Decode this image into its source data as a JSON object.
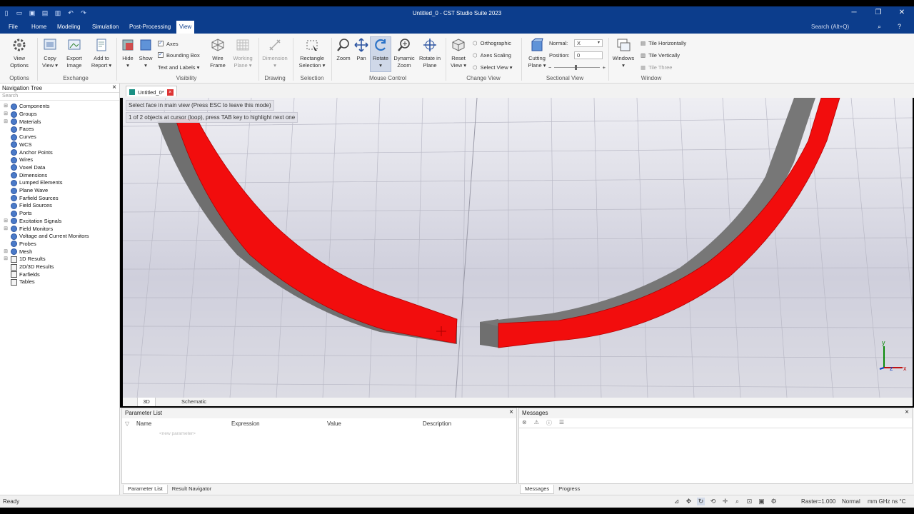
{
  "window": {
    "title": "Untitled_0 - CST Studio Suite 2023",
    "search_placeholder": "Search (Alt+Q)",
    "minimize": "─",
    "maximize": "❐",
    "close": "✕",
    "help": "?"
  },
  "quick_access": [
    "new-file-icon",
    "open-folder-icon",
    "save-icon",
    "save-all-icon",
    "print-icon",
    "undo-icon",
    "redo-icon"
  ],
  "menu": {
    "items": [
      "File",
      "Home",
      "Modeling",
      "Simulation",
      "Post-Processing",
      "View"
    ],
    "active": "View"
  },
  "ribbon": {
    "options": {
      "view_options": "View\nOptions",
      "group": "Options"
    },
    "exchange": {
      "copy_view": "Copy\nView ▾",
      "export_image": "Export\nImage",
      "add_to_report": "Add to\nReport ▾",
      "group": "Exchange"
    },
    "visibility": {
      "hide": "Hide\n▾",
      "show": "Show\n▾",
      "axes": "Axes",
      "bounding_box": "Bounding Box",
      "text_and_labels": "Text and Labels ▾",
      "wire_frame": "Wire\nFrame",
      "working_plane": "Working\nPlane ▾",
      "group": "Visibility"
    },
    "drawing": {
      "dimension": "Dimension\n▾",
      "group": "Drawing"
    },
    "selection": {
      "rectangle_selection": "Rectangle\nSelection ▾",
      "group": "Selection"
    },
    "mouse_control": {
      "zoom": "Zoom",
      "pan": "Pan",
      "rotate": "Rotate\n▾",
      "dynamic_zoom": "Dynamic\nZoom",
      "rotate_in_plane": "Rotate in\nPlane",
      "group": "Mouse Control"
    },
    "change_view": {
      "reset_view": "Reset\nView ▾",
      "orthographic": "Orthographic",
      "axes_scaling": "Axes Scaling",
      "select_view": "Select View ▾",
      "group": "Change View"
    },
    "sectional_view": {
      "cutting_plane": "Cutting\nPlane ▾",
      "normal_label": "Normal:",
      "normal_value": "X",
      "position_label": "Position:",
      "position_value": "0",
      "group": "Sectional View"
    },
    "window": {
      "windows": "Windows\n▾",
      "tile_horizontally": "Tile Horizontally",
      "tile_vertically": "Tile Vertically",
      "tile_three": "Tile Three",
      "group": "Window"
    }
  },
  "navigation_tree": {
    "title": "Navigation Tree",
    "search_placeholder": "Search",
    "items": [
      {
        "label": "Components",
        "expandable": true,
        "icon": "folder-icon"
      },
      {
        "label": "Groups",
        "expandable": true,
        "icon": "folder-icon"
      },
      {
        "label": "Materials",
        "expandable": true,
        "icon": "folder-icon"
      },
      {
        "label": "Faces",
        "expandable": false,
        "icon": "folder-icon"
      },
      {
        "label": "Curves",
        "expandable": false,
        "icon": "folder-icon"
      },
      {
        "label": "WCS",
        "expandable": false,
        "icon": "folder-icon"
      },
      {
        "label": "Anchor Points",
        "expandable": false,
        "icon": "folder-icon"
      },
      {
        "label": "Wires",
        "expandable": false,
        "icon": "folder-icon"
      },
      {
        "label": "Voxel Data",
        "expandable": false,
        "icon": "folder-icon"
      },
      {
        "label": "Dimensions",
        "expandable": false,
        "icon": "folder-icon"
      },
      {
        "label": "Lumped Elements",
        "expandable": false,
        "icon": "folder-icon"
      },
      {
        "label": "Plane Wave",
        "expandable": false,
        "icon": "folder-icon"
      },
      {
        "label": "Farfield Sources",
        "expandable": false,
        "icon": "folder-icon"
      },
      {
        "label": "Field Sources",
        "expandable": false,
        "icon": "folder-icon"
      },
      {
        "label": "Ports",
        "expandable": false,
        "icon": "folder-icon"
      },
      {
        "label": "Excitation Signals",
        "expandable": true,
        "icon": "folder-icon"
      },
      {
        "label": "Field Monitors",
        "expandable": true,
        "icon": "folder-icon"
      },
      {
        "label": "Voltage and Current Monitors",
        "expandable": false,
        "icon": "folder-icon"
      },
      {
        "label": "Probes",
        "expandable": false,
        "icon": "folder-icon"
      },
      {
        "label": "Mesh",
        "expandable": true,
        "icon": "folder-icon"
      },
      {
        "label": "1D Results",
        "expandable": true,
        "icon": "results-icon"
      },
      {
        "label": "2D/3D Results",
        "expandable": false,
        "icon": "results-icon"
      },
      {
        "label": "Farfields",
        "expandable": false,
        "icon": "results-icon"
      },
      {
        "label": "Tables",
        "expandable": false,
        "icon": "results-icon"
      }
    ]
  },
  "document": {
    "tab": "Untitled_0*",
    "hint_line1": "Select face in main view (Press ESC to leave this mode)",
    "hint_line2": "1 of 2 objects at cursor (loop), press TAB key to highlight next one",
    "view_tabs": [
      "3D",
      "Schematic"
    ],
    "axis_labels": {
      "y": "y",
      "z": "z",
      "x": "x"
    },
    "colors": {
      "face_red": "#f20d0d",
      "edge_gray": "#6f6f6f",
      "grid": "#b9b9c6"
    }
  },
  "parameter_list": {
    "title": "Parameter List",
    "columns": [
      "Name",
      "Expression",
      "Value",
      "Description"
    ],
    "new_row_placeholder": "<new parameter>",
    "tabs": [
      "Parameter List",
      "Result Navigator"
    ]
  },
  "messages": {
    "title": "Messages",
    "tabs": [
      "Messages",
      "Progress"
    ]
  },
  "statusbar": {
    "status": "Ready",
    "raster": "Raster=1.000",
    "mode": "Normal",
    "units": "mm  GHz  ns  °C"
  }
}
